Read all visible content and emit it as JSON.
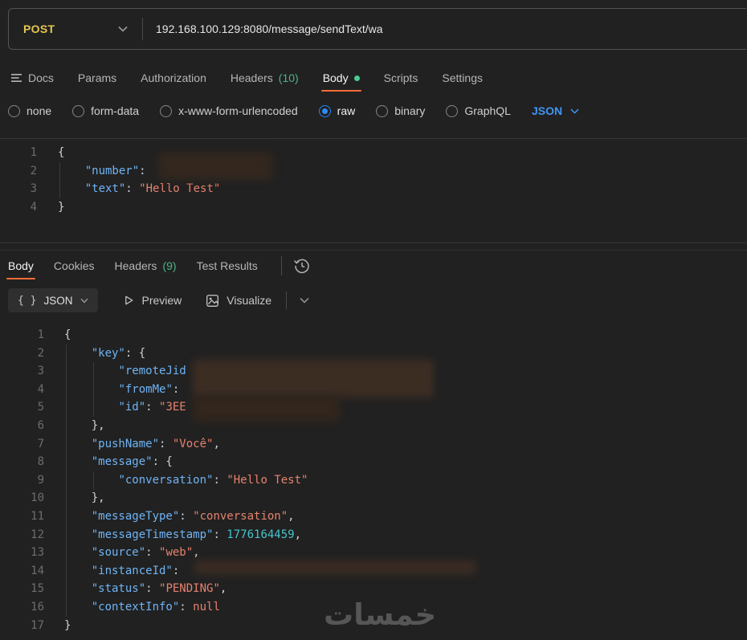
{
  "method_bar": {
    "method": "POST",
    "url": "192.168.100.129:8080/message/sendText/wa"
  },
  "request_tabs": {
    "items": [
      {
        "label": "Docs",
        "icon": "docs-list-icon"
      },
      {
        "label": "Params"
      },
      {
        "label": "Authorization"
      },
      {
        "label": "Headers",
        "count": "(10)"
      },
      {
        "label": "Body",
        "active": true,
        "dot": true
      },
      {
        "label": "Scripts"
      },
      {
        "label": "Settings"
      }
    ]
  },
  "body_type": {
    "options": [
      {
        "label": "none"
      },
      {
        "label": "form-data"
      },
      {
        "label": "x-www-form-urlencoded"
      },
      {
        "label": "raw",
        "selected": true
      },
      {
        "label": "binary"
      },
      {
        "label": "GraphQL"
      }
    ],
    "format": "JSON"
  },
  "request_editor": {
    "lines": [
      {
        "n": "1",
        "t": [
          [
            "p",
            "{"
          ]
        ]
      },
      {
        "n": "2",
        "t": [
          [
            "w",
            "    "
          ],
          [
            "k",
            "\"number\""
          ],
          [
            "p",
            ": "
          ]
        ]
      },
      {
        "n": "3",
        "t": [
          [
            "w",
            "    "
          ],
          [
            "k",
            "\"text\""
          ],
          [
            "p",
            ": "
          ],
          [
            "s",
            "\"Hello Test\""
          ]
        ]
      },
      {
        "n": "4",
        "t": [
          [
            "p",
            "}"
          ]
        ]
      }
    ]
  },
  "response_tabs": {
    "items": [
      {
        "label": "Body",
        "active": true
      },
      {
        "label": "Cookies"
      },
      {
        "label": "Headers",
        "count": "(9)"
      },
      {
        "label": "Test Results"
      }
    ]
  },
  "response_toolbar": {
    "format_button": "JSON",
    "preview": "Preview",
    "visualize": "Visualize"
  },
  "response_editor": {
    "lines": [
      {
        "n": "1",
        "t": [
          [
            "p",
            "{"
          ]
        ]
      },
      {
        "n": "2",
        "t": [
          [
            "w",
            "    "
          ],
          [
            "k",
            "\"key\""
          ],
          [
            "p",
            ": {"
          ]
        ]
      },
      {
        "n": "3",
        "t": [
          [
            "w",
            "        "
          ],
          [
            "k",
            "\"remoteJid"
          ]
        ]
      },
      {
        "n": "4",
        "t": [
          [
            "w",
            "        "
          ],
          [
            "k",
            "\"fromMe\""
          ],
          [
            "p",
            ": "
          ]
        ]
      },
      {
        "n": "5",
        "t": [
          [
            "w",
            "        "
          ],
          [
            "k",
            "\"id\""
          ],
          [
            "p",
            ": "
          ],
          [
            "s",
            "\"3EE"
          ]
        ]
      },
      {
        "n": "6",
        "t": [
          [
            "w",
            "    "
          ],
          [
            "p",
            "},"
          ]
        ]
      },
      {
        "n": "7",
        "t": [
          [
            "w",
            "    "
          ],
          [
            "k",
            "\"pushName\""
          ],
          [
            "p",
            ": "
          ],
          [
            "s",
            "\"Você\""
          ],
          [
            "p",
            ","
          ]
        ]
      },
      {
        "n": "8",
        "t": [
          [
            "w",
            "    "
          ],
          [
            "k",
            "\"message\""
          ],
          [
            "p",
            ": {"
          ]
        ]
      },
      {
        "n": "9",
        "t": [
          [
            "w",
            "        "
          ],
          [
            "k",
            "\"conversation\""
          ],
          [
            "p",
            ": "
          ],
          [
            "s",
            "\"Hello Test\""
          ]
        ]
      },
      {
        "n": "10",
        "t": [
          [
            "w",
            "    "
          ],
          [
            "p",
            "},"
          ]
        ]
      },
      {
        "n": "11",
        "t": [
          [
            "w",
            "    "
          ],
          [
            "k",
            "\"messageType\""
          ],
          [
            "p",
            ": "
          ],
          [
            "s",
            "\"conversation\""
          ],
          [
            "p",
            ","
          ]
        ]
      },
      {
        "n": "12",
        "t": [
          [
            "w",
            "    "
          ],
          [
            "k",
            "\"messageTimestamp\""
          ],
          [
            "p",
            ": "
          ],
          [
            "n",
            "1776164459"
          ],
          [
            "p",
            ","
          ]
        ]
      },
      {
        "n": "13",
        "t": [
          [
            "w",
            "    "
          ],
          [
            "k",
            "\"source\""
          ],
          [
            "p",
            ": "
          ],
          [
            "s",
            "\"web\""
          ],
          [
            "p",
            ","
          ]
        ]
      },
      {
        "n": "14",
        "t": [
          [
            "w",
            "    "
          ],
          [
            "k",
            "\"instanceId\""
          ],
          [
            "p",
            ": "
          ]
        ]
      },
      {
        "n": "15",
        "t": [
          [
            "w",
            "    "
          ],
          [
            "k",
            "\"status\""
          ],
          [
            "p",
            ": "
          ],
          [
            "s",
            "\"PENDING\""
          ],
          [
            "p",
            ","
          ]
        ]
      },
      {
        "n": "16",
        "t": [
          [
            "w",
            "    "
          ],
          [
            "k",
            "\"contextInfo\""
          ],
          [
            "p",
            ": "
          ],
          [
            "u",
            "null"
          ]
        ]
      },
      {
        "n": "17",
        "t": [
          [
            "p",
            "}"
          ]
        ]
      }
    ]
  },
  "watermark": "خمسات",
  "colors": {
    "accent_orange": "#ff6c37",
    "method_post": "#e7c64f",
    "accent_blue": "#2f8bf5",
    "success_green": "#49cc90",
    "key_blue": "#6fb4f5",
    "string_salmon": "#e8826e",
    "number_teal": "#45c5cd"
  }
}
